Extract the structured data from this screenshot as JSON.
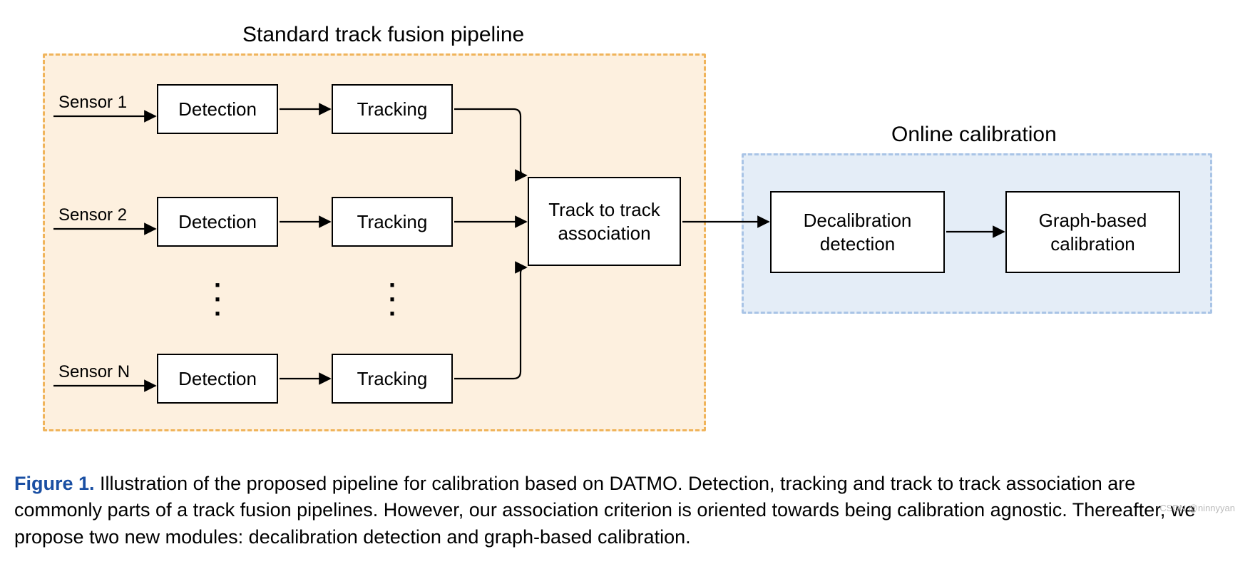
{
  "titles": {
    "pipeline": "Standard track fusion pipeline",
    "online": "Online calibration"
  },
  "sensors": {
    "s1": "Sensor 1",
    "s2": "Sensor 2",
    "sN": "Sensor N"
  },
  "nodes": {
    "detection1": "Detection",
    "tracking1": "Tracking",
    "detection2": "Detection",
    "tracking2": "Tracking",
    "detectionN": "Detection",
    "trackingN": "Tracking",
    "t2t": "Track to track association",
    "decal": "Decalibration detection",
    "graph": "Graph-based calibration"
  },
  "caption": {
    "label": "Figure 1.",
    "text": " Illustration of the proposed pipeline for calibration based on DATMO. Detection, tracking and track to track association are commonly parts of a track fusion pipelines. However, our association criterion is oriented towards being calibration agnostic. Thereafter, we propose two new modules: decalibration detection and graph-based calibration."
  },
  "watermark": "CSDN @ninnyyan"
}
